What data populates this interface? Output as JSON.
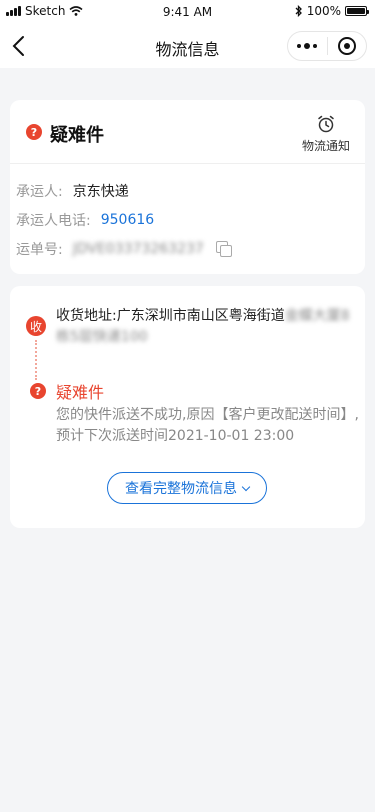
{
  "status_bar": {
    "carrier": "Sketch",
    "time": "9:41 AM",
    "battery": "100%"
  },
  "nav": {
    "title": "物流信息"
  },
  "status_card": {
    "badge": "?",
    "title": "疑难件",
    "notify_label": "物流通知",
    "carrier_label": "承运人:",
    "carrier_value": "京东快递",
    "phone_label": "承运人电话:",
    "phone_value": "950616",
    "waybill_label": "运单号:",
    "waybill_value": "JDVE03373263237"
  },
  "timeline": {
    "receive_badge": "收",
    "address_prefix": "收货地址:广东深圳市南山区粤海街道",
    "address_blurred": "金蝶大厦8栋5层快递100",
    "status_badge": "?",
    "status": "疑难件",
    "description": "您的快件派送不成功,原因【客户更改配送时间】,预计下次派送时间2021-10-01 23:00",
    "full_button": "查看完整物流信息"
  },
  "colors": {
    "accent_red": "#e8452f",
    "link_blue": "#1a73d9",
    "background": "#f4f5f7"
  }
}
